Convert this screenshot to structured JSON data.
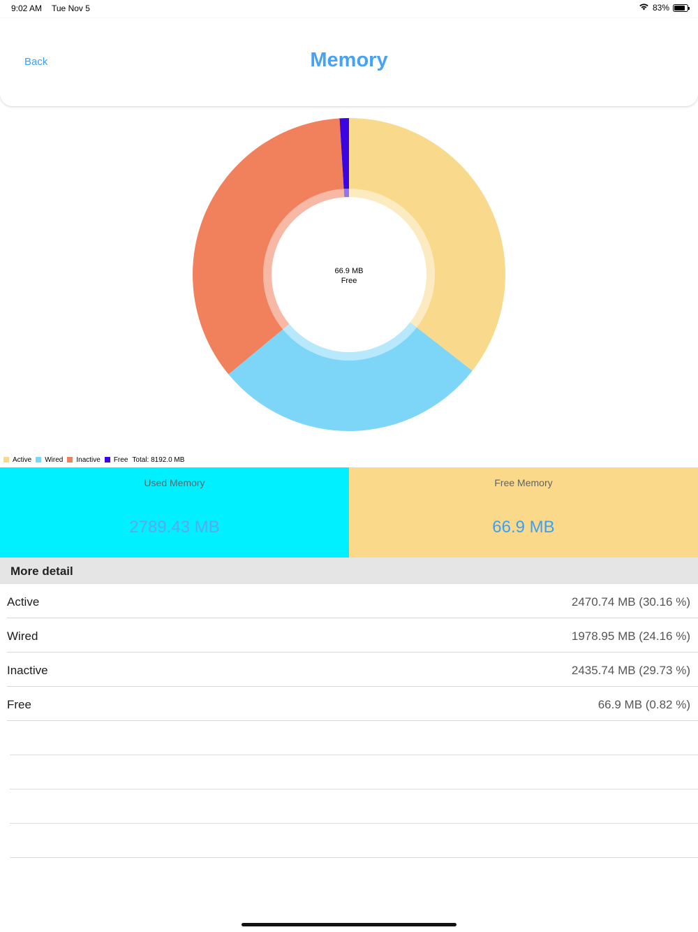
{
  "status_bar": {
    "time": "9:02 AM",
    "date": "Tue Nov 5",
    "battery": "83%",
    "battery_level": 0.83,
    "icons": [
      "wifi-icon",
      "battery-icon"
    ]
  },
  "nav": {
    "back_label": "Back",
    "title": "Memory"
  },
  "chart_data": {
    "type": "pie",
    "center_text": [
      "66.9 MB",
      "Free"
    ],
    "series": [
      {
        "name": "Active",
        "value": 2470.74,
        "color": "#f9d98c"
      },
      {
        "name": "Wired",
        "value": 1978.95,
        "color": "#7dd6f8"
      },
      {
        "name": "Inactive",
        "value": 2435.74,
        "color": "#f1805c"
      },
      {
        "name": "Free",
        "value": 66.9,
        "color": "#3a05e0"
      }
    ],
    "legend_placement": "bottom-left",
    "total_label": "Total: 8192.0 MB"
  },
  "summary": {
    "used": {
      "label": "Used Memory",
      "value": "2789.43 MB",
      "bg": "#00f0ff",
      "value_color": "#5aa8f2"
    },
    "free": {
      "label": "Free Memory",
      "value": "66.9 MB",
      "bg": "#fbd98a",
      "value_color": "#3d9ff4"
    }
  },
  "details": {
    "header": "More detail",
    "rows": [
      {
        "label": "Active",
        "value": "2470.74 MB (30.16 %)"
      },
      {
        "label": "Wired",
        "value": "1978.95 MB (24.16 %)"
      },
      {
        "label": "Inactive",
        "value": "2435.74 MB (29.73 %)"
      },
      {
        "label": "Free",
        "value": "66.9 MB (0.82 %)"
      }
    ]
  }
}
